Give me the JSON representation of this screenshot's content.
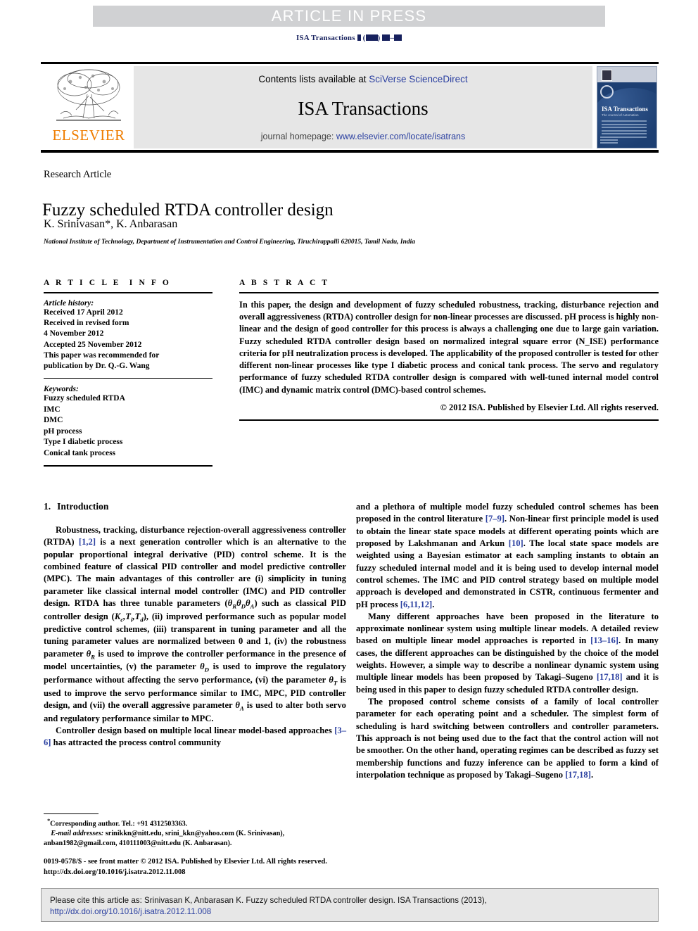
{
  "banner": {
    "text": "ARTICLE IN PRESS",
    "bg_color": "#d0d1d3",
    "text_color": "#ffffff"
  },
  "running_head": {
    "journal": "ISA Transactions",
    "volume_placeholder": "▪ (▪▪▪▪) ▪▪▪–▪▪▪",
    "color": "#17215e"
  },
  "masthead": {
    "publisher_logo_text": "ELSEVIER",
    "publisher_logo_color": "#ef7d00",
    "contents_prefix": "Contents lists available at ",
    "contents_link": "SciVerse ScienceDirect",
    "journal_name": "ISA Transactions",
    "homepage_prefix": "journal homepage: ",
    "homepage_url": "www.elsevier.com/locate/isatrans",
    "link_color": "#2a3fa0",
    "cover": {
      "title": "ISA Transactions",
      "subtitle": "The Journal of Automation",
      "bg_color": "#1d3f72"
    }
  },
  "article": {
    "type": "Research Article",
    "title": "Fuzzy scheduled RTDA controller design",
    "authors": "K. Srinivasan*, K. Anbarasan",
    "affiliation": "National Institute of Technology, Department of Instrumentation and Control Engineering, Tiruchirappalli 620015, Tamil Nadu, India"
  },
  "article_info": {
    "heading": "ARTICLE INFO",
    "history_label": "Article history:",
    "history": [
      "Received 17 April 2012",
      "Received in revised form",
      "4 November 2012",
      "Accepted 25 November 2012",
      "This paper was recommended for",
      "publication by Dr. Q.-G. Wang"
    ],
    "keywords_label": "Keywords:",
    "keywords": [
      "Fuzzy scheduled RTDA",
      "IMC",
      "DMC",
      "pH process",
      "Type I diabetic process",
      "Conical tank process"
    ]
  },
  "abstract": {
    "heading": "ABSTRACT",
    "body": "In this paper, the design and development of fuzzy scheduled robustness, tracking, disturbance rejection and overall aggressiveness (RTDA) controller design for non-linear processes are discussed. pH process is highly non-linear and the design of good controller for this process is always a challenging one due to large gain variation. Fuzzy scheduled RTDA controller design based on normalized integral square error (N_ISE) performance criteria for pH neutralization process is developed. The applicability of the proposed controller is tested for other different non-linear processes like type I diabetic process and conical tank process. The servo and regulatory performance of fuzzy scheduled RTDA controller design is compared with well-tuned internal model control (IMC) and dynamic matrix control (DMC)-based control schemes.",
    "copyright": "© 2012 ISA. Published by Elsevier Ltd. All rights reserved."
  },
  "body": {
    "section_number": "1.",
    "section_title": "Introduction",
    "left_paragraphs": [
      "Robustness, tracking, disturbance rejection-overall aggressiveness controller (RTDA) [1,2] is a next generation controller which is an alternative to the popular proportional integral derivative (PID) control scheme. It is the combined feature of classical PID controller and model predictive controller (MPC). The main advantages of this controller are (i) simplicity in tuning parameter like classical internal model controller (IMC) and PID controller design. RTDA has three tunable parameters (θRθDθA) such as classical PID controller design (Kc,Ti,Td), (ii) improved performance such as popular model predictive control schemes, (iii) transparent in tuning parameter and all the tuning parameter values are normalized between 0 and 1, (iv) the robustness parameter θR is used to improve the controller performance in the presence of model uncertainties, (v) the parameter θD is used to improve the regulatory performance without affecting the servo performance, (vi) the parameter θT is used to improve the servo performance similar to IMC, MPC, PID controller design, and (vii) the overall aggressive parameter θA is used to alter both servo and regulatory performance similar to MPC.",
      "Controller design based on multiple local linear model-based approaches [3–6] has attracted the process control community"
    ],
    "right_paragraphs": [
      "and a plethora of multiple model fuzzy scheduled control schemes has been proposed in the control literature [7–9]. Non-linear first principle model is used to obtain the linear state space models at different operating points which are proposed by Lakshmanan and Arkun [10]. The local state space models are weighted using a Bayesian estimator at each sampling instants to obtain an fuzzy scheduled internal model and it is being used to develop internal model control schemes. The IMC and PID control strategy based on multiple model approach is developed and demonstrated in CSTR, continuous fermenter and pH process [6,11,12].",
      "Many different approaches have been proposed in the literature to approximate nonlinear system using multiple linear models. A detailed review based on multiple linear model approaches is reported in [13–16]. In many cases, the different approaches can be distinguished by the choice of the model weights. However, a simple way to describe a nonlinear dynamic system using multiple linear models has been proposed by Takagi–Sugeno [17,18] and it is being used in this paper to design fuzzy scheduled RTDA controller design.",
      "The proposed control scheme consists of a family of local controller parameter for each operating point and a scheduler. The simplest form of scheduling is hard switching between controllers and controller parameters. This approach is not being used due to the fact that the control action will not be smoother. On the other hand, operating regimes can be described as fuzzy set membership functions and fuzzy inference can be applied to form a kind of interpolation technique as proposed by Takagi–Sugeno [17,18]."
    ]
  },
  "footnotes": {
    "corresponding": "Corresponding author. Tel.: +91 4312503363.",
    "email_label": "E-mail addresses:",
    "emails_line1": "srinikkn@nitt.edu, srini_kkn@yahoo.com (K. Srinivasan),",
    "emails_line2": "anban1982@gmail.com, 410111003@nitt.edu (K. Anbarasan)."
  },
  "imprint": {
    "line1": "0019-0578/$ - see front matter © 2012 ISA. Published by Elsevier Ltd. All rights reserved.",
    "line2": "http://dx.doi.org/10.1016/j.isatra.2012.11.008"
  },
  "cite_box": {
    "prefix": "Please cite this article as: Srinivasan K, Anbarasan K. Fuzzy scheduled RTDA controller design. ISA Transactions (2013), ",
    "doi": "http://dx.doi.org/10.1016/j.isatra.2012.11.008",
    "bg_color": "#e7e7e7"
  }
}
